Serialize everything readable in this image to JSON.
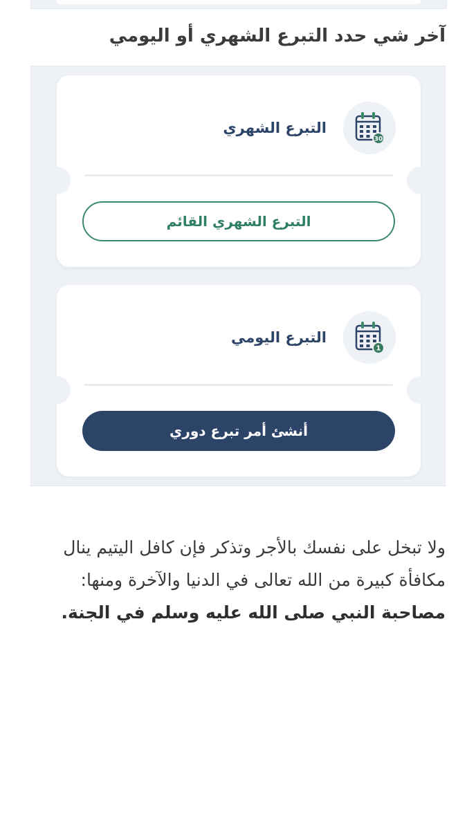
{
  "heading": "آخر شي حدد التبرع الشهري أو اليومي",
  "monthly_card": {
    "title": "التبرع الشهري",
    "icon": "calendar-30-icon",
    "badge": "30",
    "button_label": "التبرع الشهري القائم"
  },
  "daily_card": {
    "title": "التبرع اليومي",
    "icon": "calendar-1-icon",
    "badge": "1",
    "button_label": "أنشئ أمر تبرع دوري"
  },
  "paragraph": {
    "text": "ولا تبخل على نفسك بالأجر وتذكر فإن كافل اليتيم ينال مكافأة كبيرة من الله تعالى في الدنيا والآخرة ومنها: ",
    "bold_text": "مصاحبة النبي صلى الله عليه وسلم في الجنة."
  },
  "colors": {
    "navy": "#2c4468",
    "green": "#3a8a6b",
    "panel_bg": "#eef1f6"
  }
}
